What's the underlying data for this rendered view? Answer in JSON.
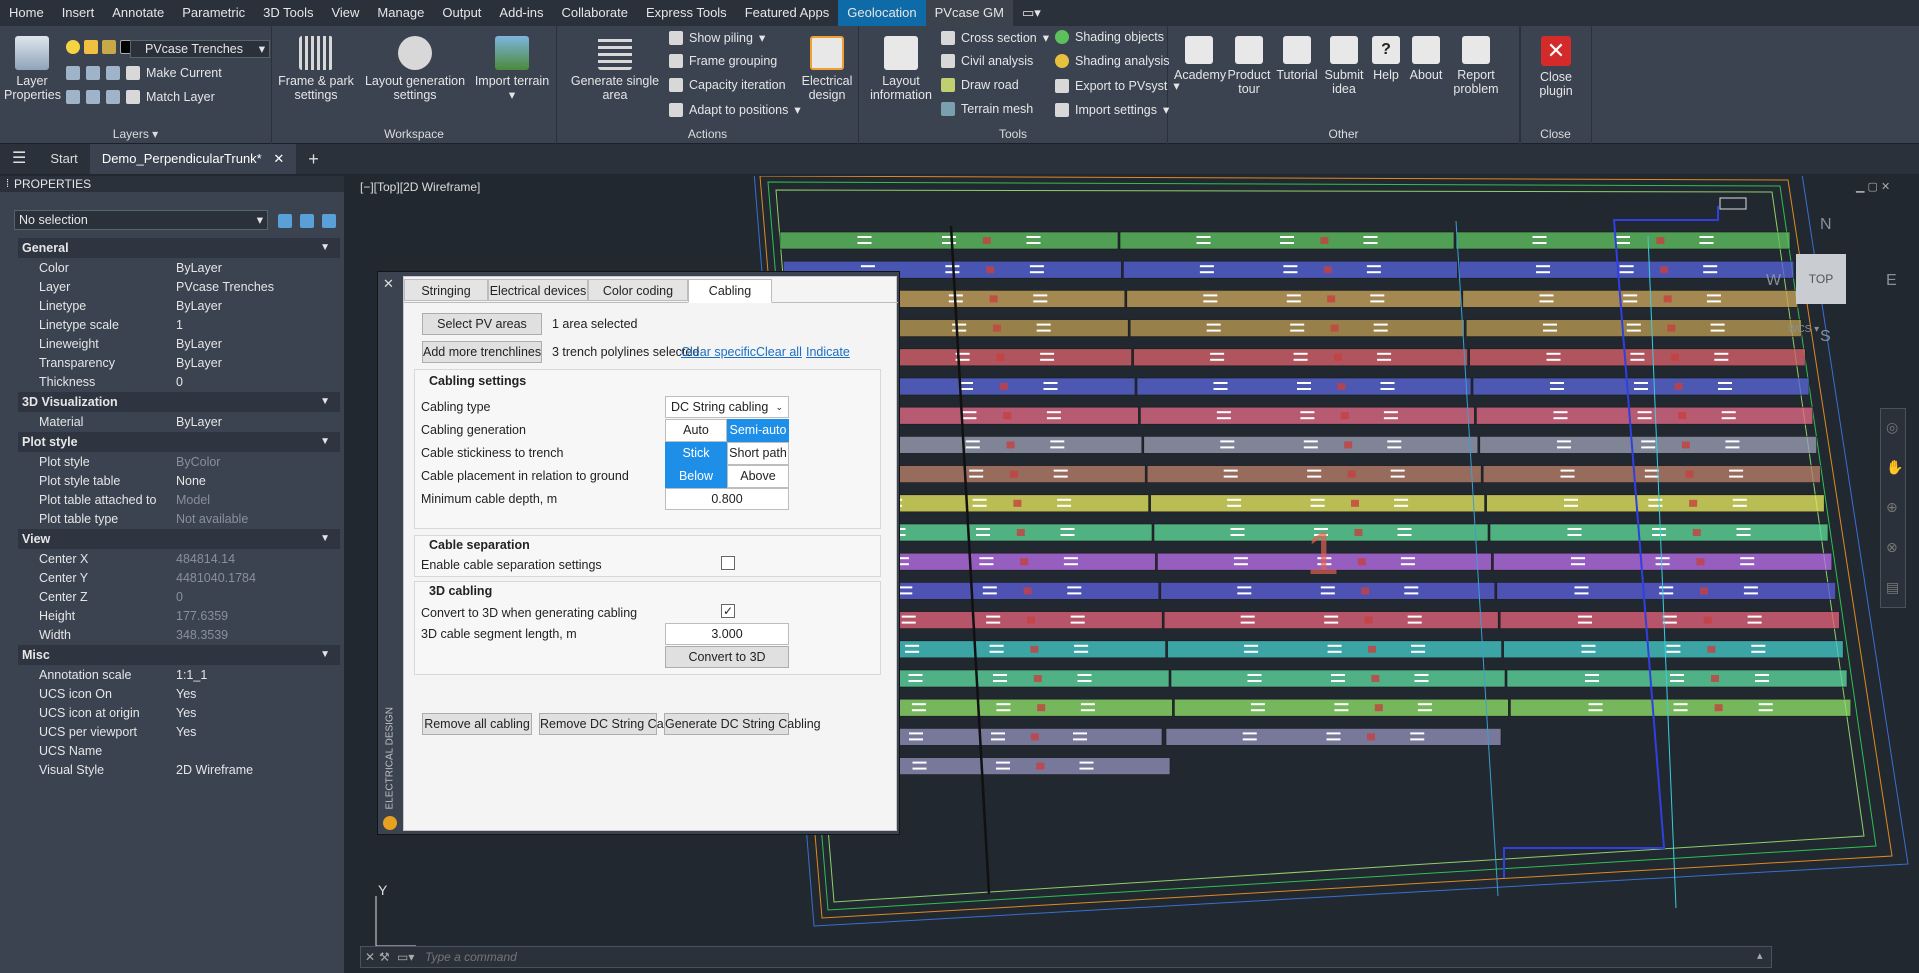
{
  "menu": [
    "Home",
    "Insert",
    "Annotate",
    "Parametric",
    "3D Tools",
    "View",
    "Manage",
    "Output",
    "Add-ins",
    "Collaborate",
    "Express Tools",
    "Featured Apps",
    "Geolocation",
    "PVcase GM"
  ],
  "ribbon": {
    "layers": {
      "layer_properties": "Layer\nProperties",
      "layer_dropdown": "PVcase Trenches",
      "make_current": "Make Current",
      "match_layer": "Match Layer",
      "title": "Layers"
    },
    "workspace": {
      "frame_park": "Frame & park\nsettings",
      "layout_gen": "Layout generation\nsettings",
      "import_terrain": "Import terrain",
      "title": "Workspace"
    },
    "actions": {
      "generate_single": "Generate single\narea",
      "show_piling": "Show piling",
      "frame_grouping": "Frame grouping",
      "capacity_iteration": "Capacity iteration",
      "adapt_positions": "Adapt to positions",
      "electrical_design": "Electrical\ndesign",
      "title": "Actions"
    },
    "tools": {
      "layout_info": "Layout\ninformation",
      "cross_section": "Cross section",
      "civil_analysis": "Civil analysis",
      "draw_road": "Draw road",
      "terrain_mesh": "Terrain mesh",
      "shading_objects": "Shading objects",
      "shading_analysis": "Shading analysis",
      "export_pvsyst": "Export to PVsyst",
      "import_settings": "Import settings",
      "title": "Tools"
    },
    "other": {
      "academy": "Academy",
      "product_tour": "Product\ntour",
      "tutorial": "Tutorial",
      "submit_idea": "Submit\nidea",
      "help": "Help",
      "about": "About",
      "report_problem": "Report\nproblem",
      "title": "Other"
    },
    "close": {
      "close_plugin": "Close\nplugin",
      "title": "Close"
    }
  },
  "doctabs": {
    "start": "Start",
    "doc": "Demo_PerpendicularTrunk*"
  },
  "properties": {
    "header": "PROPERTIES",
    "selection": "No selection",
    "sections": [
      {
        "title": "General",
        "rows": [
          [
            "Color",
            "ByLayer"
          ],
          [
            "Layer",
            "PVcase Trenches"
          ],
          [
            "Linetype",
            "ByLayer"
          ],
          [
            "Linetype scale",
            "1"
          ],
          [
            "Lineweight",
            "ByLayer"
          ],
          [
            "Transparency",
            "ByLayer"
          ],
          [
            "Thickness",
            "0"
          ]
        ]
      },
      {
        "title": "3D Visualization",
        "rows": [
          [
            "Material",
            "ByLayer"
          ]
        ]
      },
      {
        "title": "Plot style",
        "rows": [
          [
            "Plot style",
            "ByColor"
          ],
          [
            "Plot style table",
            "None"
          ],
          [
            "Plot table attached to",
            "Model"
          ],
          [
            "Plot table type",
            "Not available"
          ]
        ]
      },
      {
        "title": "View",
        "rows": [
          [
            "Center X",
            "484814.14"
          ],
          [
            "Center Y",
            "4481040.1784"
          ],
          [
            "Center Z",
            "0"
          ],
          [
            "Height",
            "177.6359"
          ],
          [
            "Width",
            "348.3539"
          ]
        ]
      },
      {
        "title": "Misc",
        "rows": [
          [
            "Annotation scale",
            "1:1_1"
          ],
          [
            "UCS icon On",
            "Yes"
          ],
          [
            "UCS icon at origin",
            "Yes"
          ],
          [
            "UCS per viewport",
            "Yes"
          ],
          [
            "UCS Name",
            ""
          ],
          [
            "Visual Style",
            "2D Wireframe"
          ]
        ]
      }
    ]
  },
  "viewport": {
    "label": "[−][Top][2D Wireframe]",
    "compass": {
      "n": "N",
      "s": "S",
      "e": "E",
      "w": "W",
      "top": "TOP",
      "wcs": "WCS"
    },
    "area_number": "1",
    "ucs_y": "Y"
  },
  "dialog": {
    "side_label": "ELECTRICAL DESIGN",
    "tabs": [
      "Stringing",
      "Electrical devices",
      "Color coding",
      "Cabling"
    ],
    "select_pv": "Select PV areas",
    "area_selected": "1 area selected",
    "add_trench": "Add more trenchlines",
    "trench_selected": "3 trench polylines selected",
    "clear_specific": "Clear specific",
    "clear_all": "Clear all",
    "indicate": "Indicate",
    "cabling_settings": "Cabling settings",
    "cabling_type_label": "Cabling type",
    "cabling_type_value": "DC String cabling",
    "cabling_gen_label": "Cabling generation",
    "auto": "Auto",
    "semi_auto": "Semi-auto",
    "stickiness_label": "Cable stickiness to trench",
    "stick": "Stick",
    "short_path": "Short path",
    "placement_label": "Cable placement in relation to ground",
    "below": "Below",
    "above": "Above",
    "min_depth_label": "Minimum cable depth, m",
    "min_depth_value": "0.800",
    "cable_separation": "Cable separation",
    "enable_sep_label": "Enable cable separation settings",
    "cabling_3d": "3D cabling",
    "convert_3d_label": "Convert to 3D when generating cabling",
    "segment_label": "3D cable segment length, m",
    "segment_value": "3.000",
    "convert_3d_btn": "Convert to 3D",
    "remove_all": "Remove all cabling",
    "remove_dc": "Remove DC String Cabling",
    "generate_dc": "Generate DC String Cabling"
  },
  "cmdline": {
    "placeholder": "Type a command"
  }
}
